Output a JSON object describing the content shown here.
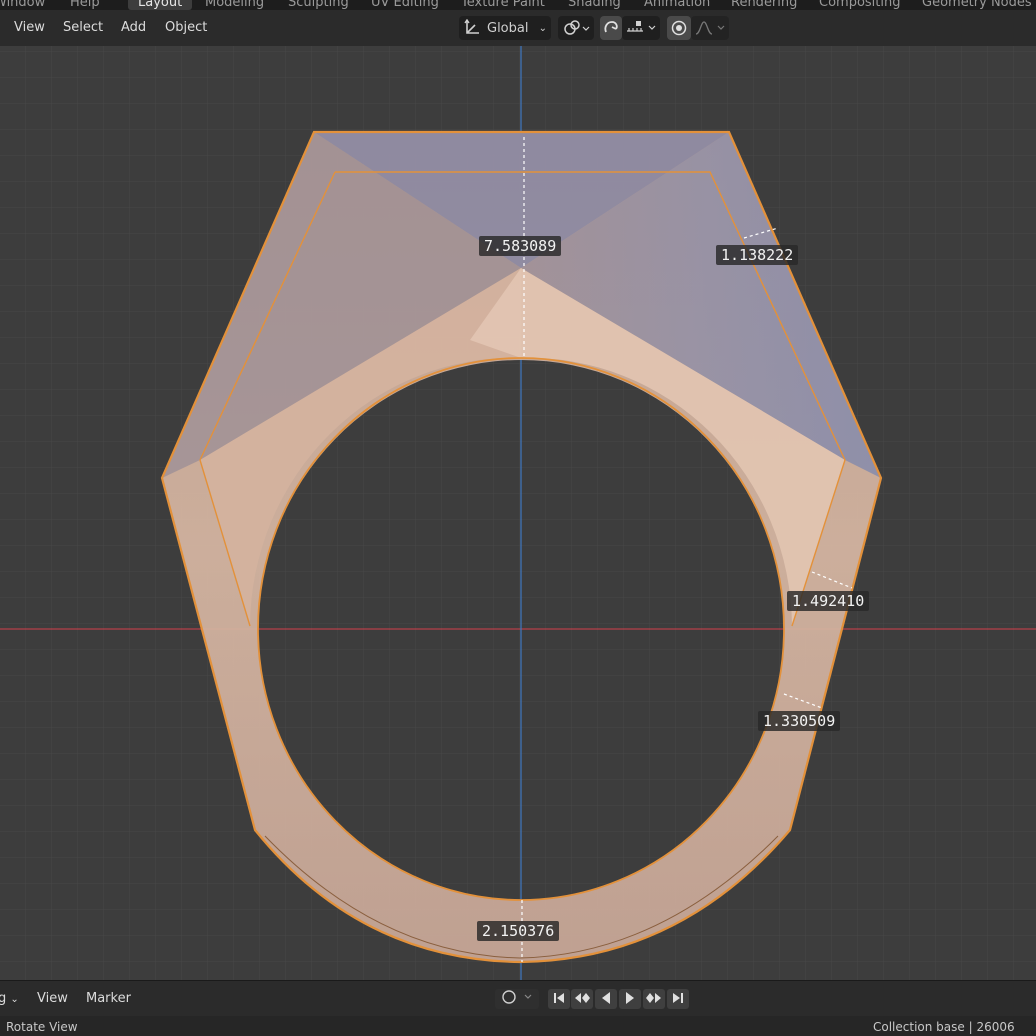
{
  "workspace_tabs": [
    "Window",
    "Help",
    "Layout",
    "Modeling",
    "Sculpting",
    "UV Editing",
    "Texture Paint",
    "Shading",
    "Animation",
    "Rendering",
    "Compositing",
    "Geometry Nodes"
  ],
  "active_workspace": "Layout",
  "header": {
    "menus": [
      "View",
      "Select",
      "Add",
      "Object"
    ],
    "transform_orientation": "Global",
    "icons": [
      "orientation-icon",
      "snap-link-icon",
      "snap-magnet-icon",
      "snap-increment-icon",
      "proportional-edit-icon",
      "falloff-curve-icon"
    ]
  },
  "measurements": [
    "7.583089",
    "1.138222",
    "1.492410",
    "1.330509",
    "2.150376"
  ],
  "colors": {
    "outline": "#e3913a",
    "mesh_fill": "#e8c9b4",
    "x_axis": "#b6404a",
    "y_axis": "#3f78c1",
    "grid": "#4a4a4a",
    "background": "#3d3d3d"
  },
  "timeline": {
    "menus": [
      "g",
      "View",
      "Marker"
    ],
    "playback_icons": [
      "jump-start-icon",
      "prev-keyframe-icon",
      "play-reverse-icon",
      "play-icon",
      "next-keyframe-icon",
      "jump-end-icon"
    ]
  },
  "status": {
    "left": "Rotate View",
    "right": "Collection base | 26006"
  }
}
